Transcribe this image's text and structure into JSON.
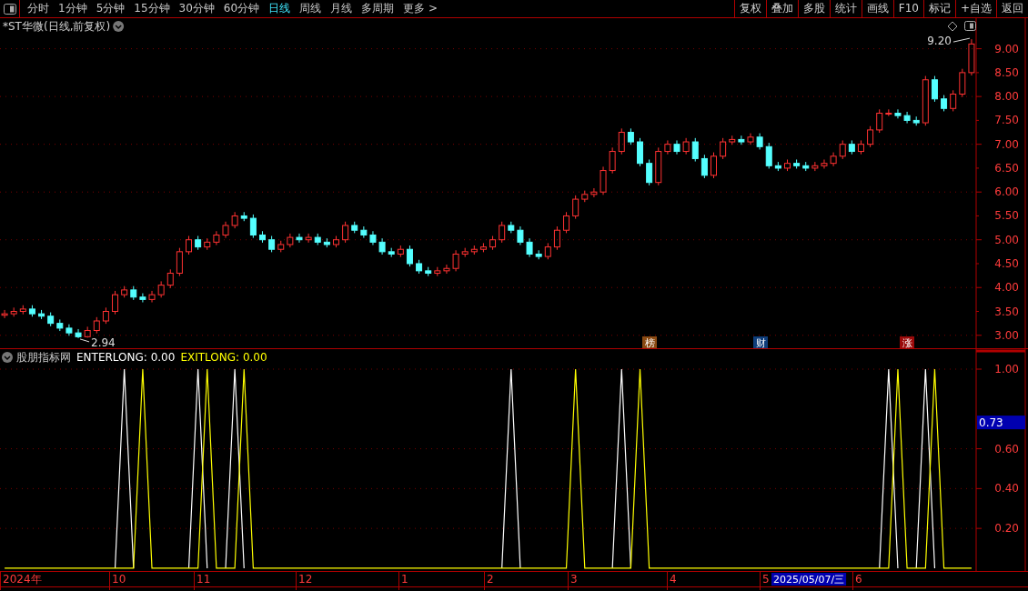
{
  "toolbar": {
    "periods": [
      {
        "label": "分时",
        "selected": false
      },
      {
        "label": "1分钟",
        "selected": false
      },
      {
        "label": "5分钟",
        "selected": false
      },
      {
        "label": "15分钟",
        "selected": false
      },
      {
        "label": "30分钟",
        "selected": false
      },
      {
        "label": "60分钟",
        "selected": false
      },
      {
        "label": "日线",
        "selected": true
      },
      {
        "label": "周线",
        "selected": false
      },
      {
        "label": "月线",
        "selected": false
      },
      {
        "label": "多周期",
        "selected": false
      },
      {
        "label": "更多 >",
        "selected": false
      }
    ],
    "actions": [
      "复权",
      "叠加",
      "多股",
      "统计",
      "画线",
      "F10",
      "标记",
      "+自选",
      "返回"
    ]
  },
  "main_chart": {
    "title": "*ST华微(日线,前复权)",
    "chart_data": {
      "type": "candlestick",
      "ohlc": [
        [
          3.42,
          3.53,
          3.36,
          3.45
        ],
        [
          3.45,
          3.58,
          3.39,
          3.5
        ],
        [
          3.5,
          3.63,
          3.44,
          3.55
        ],
        [
          3.55,
          3.63,
          3.39,
          3.45
        ],
        [
          3.45,
          3.53,
          3.34,
          3.4
        ],
        [
          3.4,
          3.48,
          3.19,
          3.25
        ],
        [
          3.25,
          3.33,
          3.09,
          3.15
        ],
        [
          3.15,
          3.23,
          2.99,
          3.05
        ],
        [
          3.05,
          3.13,
          2.94,
          2.97
        ],
        [
          2.97,
          3.18,
          2.95,
          3.1
        ],
        [
          3.1,
          3.38,
          3.04,
          3.3
        ],
        [
          3.3,
          3.58,
          3.24,
          3.5
        ],
        [
          3.5,
          3.93,
          3.44,
          3.85
        ],
        [
          3.85,
          4.03,
          3.79,
          3.95
        ],
        [
          3.95,
          4.03,
          3.74,
          3.8
        ],
        [
          3.8,
          3.88,
          3.69,
          3.75
        ],
        [
          3.75,
          3.93,
          3.69,
          3.85
        ],
        [
          3.85,
          4.13,
          3.79,
          4.05
        ],
        [
          4.05,
          4.38,
          3.99,
          4.3
        ],
        [
          4.3,
          4.83,
          4.24,
          4.75
        ],
        [
          4.75,
          5.08,
          4.69,
          5.0
        ],
        [
          5.0,
          5.08,
          4.79,
          4.85
        ],
        [
          4.85,
          5.03,
          4.79,
          4.95
        ],
        [
          4.95,
          5.18,
          4.89,
          5.1
        ],
        [
          5.1,
          5.38,
          5.04,
          5.3
        ],
        [
          5.3,
          5.58,
          5.24,
          5.5
        ],
        [
          5.5,
          5.58,
          5.39,
          5.45
        ],
        [
          5.45,
          5.53,
          5.04,
          5.1
        ],
        [
          5.1,
          5.18,
          4.94,
          5.0
        ],
        [
          5.0,
          5.08,
          4.74,
          4.8
        ],
        [
          4.8,
          4.98,
          4.74,
          4.9
        ],
        [
          4.9,
          5.13,
          4.84,
          5.05
        ],
        [
          5.05,
          5.13,
          4.94,
          5.0
        ],
        [
          5.0,
          5.13,
          4.94,
          5.05
        ],
        [
          5.05,
          5.13,
          4.89,
          4.95
        ],
        [
          4.95,
          5.03,
          4.84,
          4.9
        ],
        [
          4.9,
          5.08,
          4.84,
          5.0
        ],
        [
          5.0,
          5.38,
          4.94,
          5.3
        ],
        [
          5.3,
          5.38,
          5.14,
          5.2
        ],
        [
          5.2,
          5.28,
          5.04,
          5.1
        ],
        [
          5.1,
          5.18,
          4.89,
          4.95
        ],
        [
          4.95,
          5.03,
          4.69,
          4.75
        ],
        [
          4.75,
          4.83,
          4.64,
          4.7
        ],
        [
          4.7,
          4.88,
          4.64,
          4.8
        ],
        [
          4.8,
          4.88,
          4.44,
          4.5
        ],
        [
          4.5,
          4.58,
          4.29,
          4.35
        ],
        [
          4.35,
          4.43,
          4.24,
          4.3
        ],
        [
          4.3,
          4.43,
          4.24,
          4.35
        ],
        [
          4.35,
          4.48,
          4.29,
          4.4
        ],
        [
          4.4,
          4.78,
          4.34,
          4.7
        ],
        [
          4.7,
          4.83,
          4.64,
          4.75
        ],
        [
          4.75,
          4.88,
          4.69,
          4.8
        ],
        [
          4.8,
          4.93,
          4.74,
          4.85
        ],
        [
          4.85,
          5.08,
          4.79,
          5.0
        ],
        [
          5.0,
          5.38,
          4.94,
          5.3
        ],
        [
          5.3,
          5.38,
          5.14,
          5.2
        ],
        [
          5.2,
          5.28,
          4.89,
          4.95
        ],
        [
          4.95,
          5.03,
          4.64,
          4.7
        ],
        [
          4.7,
          4.78,
          4.59,
          4.65
        ],
        [
          4.65,
          4.93,
          4.59,
          4.85
        ],
        [
          4.85,
          5.28,
          4.79,
          5.2
        ],
        [
          5.2,
          5.58,
          5.14,
          5.5
        ],
        [
          5.5,
          5.93,
          5.44,
          5.85
        ],
        [
          5.85,
          6.03,
          5.79,
          5.95
        ],
        [
          5.95,
          6.08,
          5.89,
          6.0
        ],
        [
          6.0,
          6.53,
          5.94,
          6.45
        ],
        [
          6.45,
          6.93,
          6.39,
          6.85
        ],
        [
          6.85,
          7.33,
          6.79,
          7.25
        ],
        [
          7.25,
          7.33,
          6.99,
          7.05
        ],
        [
          7.05,
          7.13,
          6.54,
          6.6
        ],
        [
          6.6,
          6.68,
          6.14,
          6.2
        ],
        [
          6.2,
          6.93,
          6.14,
          6.85
        ],
        [
          6.85,
          7.08,
          6.79,
          7.0
        ],
        [
          7.0,
          7.08,
          6.79,
          6.85
        ],
        [
          6.85,
          7.13,
          6.79,
          7.05
        ],
        [
          7.05,
          7.13,
          6.64,
          6.7
        ],
        [
          6.7,
          6.78,
          6.29,
          6.35
        ],
        [
          6.35,
          6.83,
          6.29,
          6.75
        ],
        [
          6.75,
          7.13,
          6.69,
          7.05
        ],
        [
          7.05,
          7.18,
          6.99,
          7.1
        ],
        [
          7.1,
          7.18,
          6.99,
          7.05
        ],
        [
          7.05,
          7.23,
          6.99,
          7.15
        ],
        [
          7.15,
          7.23,
          6.89,
          6.95
        ],
        [
          6.95,
          7.03,
          6.49,
          6.55
        ],
        [
          6.55,
          6.63,
          6.44,
          6.5
        ],
        [
          6.5,
          6.68,
          6.44,
          6.6
        ],
        [
          6.6,
          6.68,
          6.49,
          6.55
        ],
        [
          6.55,
          6.63,
          6.44,
          6.5
        ],
        [
          6.5,
          6.63,
          6.44,
          6.55
        ],
        [
          6.55,
          6.68,
          6.49,
          6.6
        ],
        [
          6.6,
          6.83,
          6.54,
          6.75
        ],
        [
          6.75,
          7.08,
          6.69,
          7.0
        ],
        [
          7.0,
          7.08,
          6.79,
          6.85
        ],
        [
          6.85,
          7.08,
          6.79,
          7.0
        ],
        [
          7.0,
          7.38,
          6.94,
          7.3
        ],
        [
          7.3,
          7.73,
          7.24,
          7.65
        ],
        [
          7.65,
          7.73,
          7.59,
          7.65
        ],
        [
          7.65,
          7.73,
          7.54,
          7.6
        ],
        [
          7.6,
          7.68,
          7.44,
          7.5
        ],
        [
          7.5,
          7.58,
          7.39,
          7.45
        ],
        [
          7.45,
          8.43,
          7.39,
          8.35
        ],
        [
          8.35,
          8.43,
          7.89,
          7.95
        ],
        [
          7.95,
          8.03,
          7.69,
          7.75
        ],
        [
          7.75,
          8.13,
          7.69,
          8.05
        ],
        [
          8.05,
          8.58,
          7.99,
          8.5
        ],
        [
          8.5,
          9.2,
          8.44,
          9.1
        ]
      ],
      "ylim": [
        2.71,
        9.64
      ],
      "grid": true,
      "yticks": [
        {
          "value": 3,
          "label": "3.00"
        },
        {
          "value": 3.5,
          "label": "3.50"
        },
        {
          "value": 4,
          "label": "4.00"
        },
        {
          "value": 4.5,
          "label": "4.50"
        },
        {
          "value": 5,
          "label": "5.00"
        },
        {
          "value": 5.5,
          "label": "5.50"
        },
        {
          "value": 6,
          "label": "6.00"
        },
        {
          "value": 6.5,
          "label": "6.50"
        },
        {
          "value": 7,
          "label": "7.00"
        },
        {
          "value": 7.5,
          "label": "7.50"
        },
        {
          "value": 8,
          "label": "8.00"
        },
        {
          "value": 8.5,
          "label": "8.50"
        },
        {
          "value": 9,
          "label": "9.00"
        }
      ],
      "annotations": [
        "9.20",
        "2.94"
      ]
    },
    "event_tags": [
      {
        "text": "榜",
        "color": "#8a4a12"
      },
      {
        "text": "财",
        "color": "#0e3d7a"
      },
      {
        "text": "涨",
        "color": "#9a0a0a"
      }
    ],
    "date_axis": [
      "2024年",
      "10",
      "11",
      "12",
      "1",
      "2",
      "3",
      "4",
      "5",
      "6"
    ],
    "cursor_date": "2025/05/07/三"
  },
  "indicator": {
    "title": "股朋指标网",
    "readouts": [
      ": 0.00",
      ": 0.00"
    ],
    "cursor_value": "0.73",
    "chart_data": {
      "type": "line",
      "ylim": [
        -0.014,
        1
      ],
      "grid": true,
      "yticks": [
        {
          "value": 0.2,
          "label": "0.20"
        },
        {
          "value": 0.4,
          "label": "0.40"
        },
        {
          "value": 0.6,
          "label": "0.60"
        },
        {
          "value": 1,
          "label": "1.00"
        }
      ],
      "series": [
        {
          "name": "ENTERLONG",
          "color": "#ffffff",
          "values": [
            null,
            null,
            null,
            null,
            null,
            null,
            null,
            null,
            null,
            null,
            null,
            null,
            0,
            1,
            0,
            null,
            null,
            null,
            null,
            null,
            0,
            1,
            0,
            null,
            0,
            1,
            0,
            null,
            null,
            null,
            null,
            null,
            null,
            null,
            null,
            null,
            null,
            null,
            null,
            null,
            null,
            null,
            null,
            null,
            null,
            null,
            null,
            null,
            null,
            null,
            null,
            null,
            null,
            null,
            0,
            1,
            0,
            null,
            null,
            null,
            null,
            null,
            null,
            null,
            null,
            null,
            0,
            1,
            0,
            null,
            null,
            null,
            null,
            null,
            null,
            null,
            null,
            null,
            null,
            null,
            null,
            null,
            null,
            null,
            null,
            null,
            null,
            null,
            null,
            null,
            null,
            null,
            null,
            null,
            null,
            0,
            1,
            0,
            null,
            0,
            1,
            0,
            null,
            null,
            null,
            null
          ]
        },
        {
          "name": "EXITLONG",
          "color": "#ffff00",
          "values": [
            0,
            0,
            0,
            0,
            0,
            0,
            0,
            0,
            0,
            0,
            0,
            0,
            0,
            0,
            0,
            1,
            0,
            0,
            0,
            0,
            0,
            0,
            1,
            0,
            0,
            0,
            1,
            0,
            0,
            0,
            0,
            0,
            0,
            0,
            0,
            0,
            0,
            0,
            0,
            0,
            0,
            0,
            0,
            0,
            0,
            0,
            0,
            0,
            0,
            0,
            0,
            0,
            0,
            0,
            0,
            0,
            0,
            0,
            0,
            0,
            0,
            0,
            1,
            0,
            0,
            0,
            0,
            0,
            0,
            1,
            0,
            0,
            0,
            0,
            0,
            0,
            0,
            0,
            0,
            0,
            0,
            0,
            0,
            0,
            0,
            0,
            0,
            0,
            0,
            0,
            0,
            0,
            0,
            0,
            0,
            0,
            0,
            1,
            0,
            0,
            0,
            1,
            0,
            0,
            0,
            0
          ]
        }
      ]
    }
  }
}
